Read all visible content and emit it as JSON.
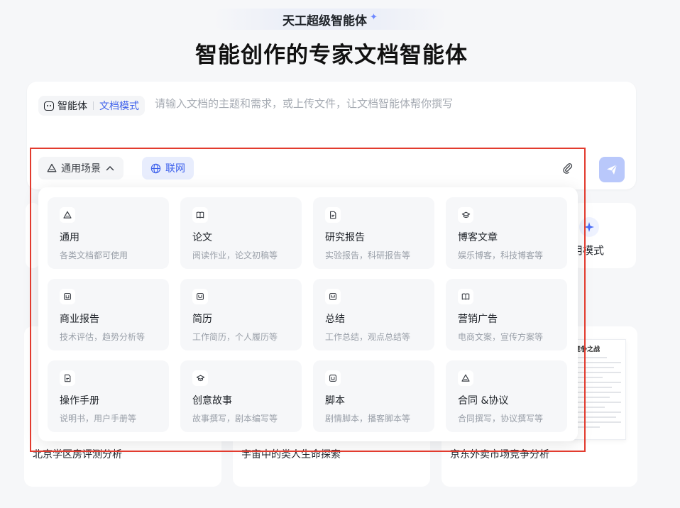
{
  "brand": {
    "name": "天工超级智能体"
  },
  "hero": {
    "title": "智能创作的专家文档智能体"
  },
  "composer": {
    "agent_label": "智能体",
    "mode_label": "文档模式",
    "placeholder": "请输入文档的主题和需求，或上传文件，让文档智能体帮你撰写",
    "scene_button": "通用场景",
    "web_button": "联网"
  },
  "behind": {
    "mode_text": "用模式",
    "cards": [
      {
        "title": "北京学区房评测分析"
      },
      {
        "title": "宇宙中的类人生命探索"
      },
      {
        "title": "京东外卖市场竞争分析",
        "thumb_heading": "竞争之战"
      }
    ]
  },
  "scenes": [
    {
      "icon": "triangle-icon",
      "name": "通用",
      "desc": "各类文档都可使用"
    },
    {
      "icon": "book-icon",
      "name": "论文",
      "desc": "阅读作业，论文初稿等"
    },
    {
      "icon": "document-icon",
      "name": "研究报告",
      "desc": "实验报告，科研报告等"
    },
    {
      "icon": "graduation-cap-icon",
      "name": "博客文章",
      "desc": "娱乐博客，科技博客等"
    },
    {
      "icon": "report-icon",
      "name": "商业报告",
      "desc": "技术评估，趋势分析等"
    },
    {
      "icon": "resume-icon",
      "name": "简历",
      "desc": "工作简历，个人履历等"
    },
    {
      "icon": "summary-icon",
      "name": "总结",
      "desc": "工作总结，观点总结等"
    },
    {
      "icon": "book-icon",
      "name": "营销广告",
      "desc": "电商文案，宣传方案等"
    },
    {
      "icon": "document-icon",
      "name": "操作手册",
      "desc": "说明书，用户手册等"
    },
    {
      "icon": "graduation-cap-icon",
      "name": "创意故事",
      "desc": "故事撰写，剧本编写等"
    },
    {
      "icon": "report-icon",
      "name": "脚本",
      "desc": "剧情脚本，播客脚本等"
    },
    {
      "icon": "triangle-icon",
      "name": "合同 &协议",
      "desc": "合同撰写，协议撰写等"
    }
  ],
  "colors": {
    "accent": "#3f62ec",
    "highlight": "#e23b2e",
    "send": "#b9c8fb"
  }
}
